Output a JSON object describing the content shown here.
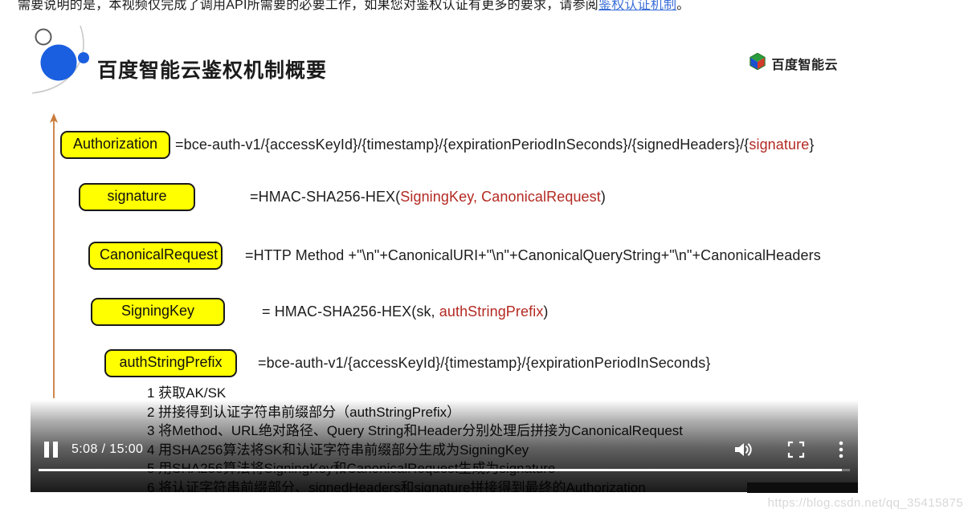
{
  "page": {
    "intro_prefix": "需要说明的是，本视频仅完成了调用API所需要的必要工作，如果您对鉴权认证有更多的要求，请参阅",
    "intro_link": "鉴权认证机制",
    "intro_suffix": "。"
  },
  "slide": {
    "title": "百度智能云鉴权机制概要",
    "brand": "百度智能云",
    "brand_icon": "baidu-cloud-hexagon-icon",
    "deco_icon": "blue-circle-decoration",
    "arrow_icon": "upward-arrow",
    "arrow_color": "#c97c3c",
    "tag_bg": "#ffff00",
    "highlight_color": "#b32a22",
    "rows": [
      {
        "tag": "Authorization",
        "expr_pre": "=bce-auth-v1/{accessKeyId}/{timestamp}/{expirationPeriodInSeconds}/{signedHeaders}/{",
        "expr_hl": "signature",
        "expr_post": "}"
      },
      {
        "tag": "signature",
        "expr_pre": "=HMAC-SHA256-HEX(",
        "expr_hl": "SigningKey, CanonicalRequest",
        "expr_post": ")"
      },
      {
        "tag": "CanonicalRequest",
        "expr_pre": "=HTTP Method +\"\\n\"+CanonicalURI+\"\\n\"+CanonicalQueryString+\"\\n\"+CanonicalHeaders",
        "expr_hl": "",
        "expr_post": ""
      },
      {
        "tag": "SigningKey",
        "expr_pre": "= HMAC-SHA256-HEX(sk, ",
        "expr_hl": "authStringPrefix",
        "expr_post": ")"
      },
      {
        "tag": "authStringPrefix",
        "expr_pre": "=bce-auth-v1/{accessKeyId}/{timestamp}/{expirationPeriodInSeconds}",
        "expr_hl": "",
        "expr_post": ""
      }
    ],
    "steps": [
      "1 获取AK/SK",
      "2 拼接得到认证字符串前缀部分（authStringPrefix）",
      "3 将Method、URL绝对路径、Query String和Header分别处理后拼接为CanonicalRequest",
      "4 用SHA256算法将SK和认证字符串前缀部分生成为SigningKey",
      "5 用SHA256算法将SigningKey和CanonicalRequest生成为signature",
      "6 将认证字符串前缀部分、signedHeaders和signature拼接得到最终的Authorization"
    ]
  },
  "player": {
    "pause_icon": "pause-icon",
    "current_time": "5:08",
    "separator": " / ",
    "duration": "15:00",
    "time_display": "5:08 / 15:00",
    "volume_icon": "volume-icon",
    "fullscreen_icon": "fullscreen-icon",
    "more_icon": "more-options-icon",
    "progress_percent": 99
  },
  "watermark": "https://blog.csdn.net/qq_35415875"
}
